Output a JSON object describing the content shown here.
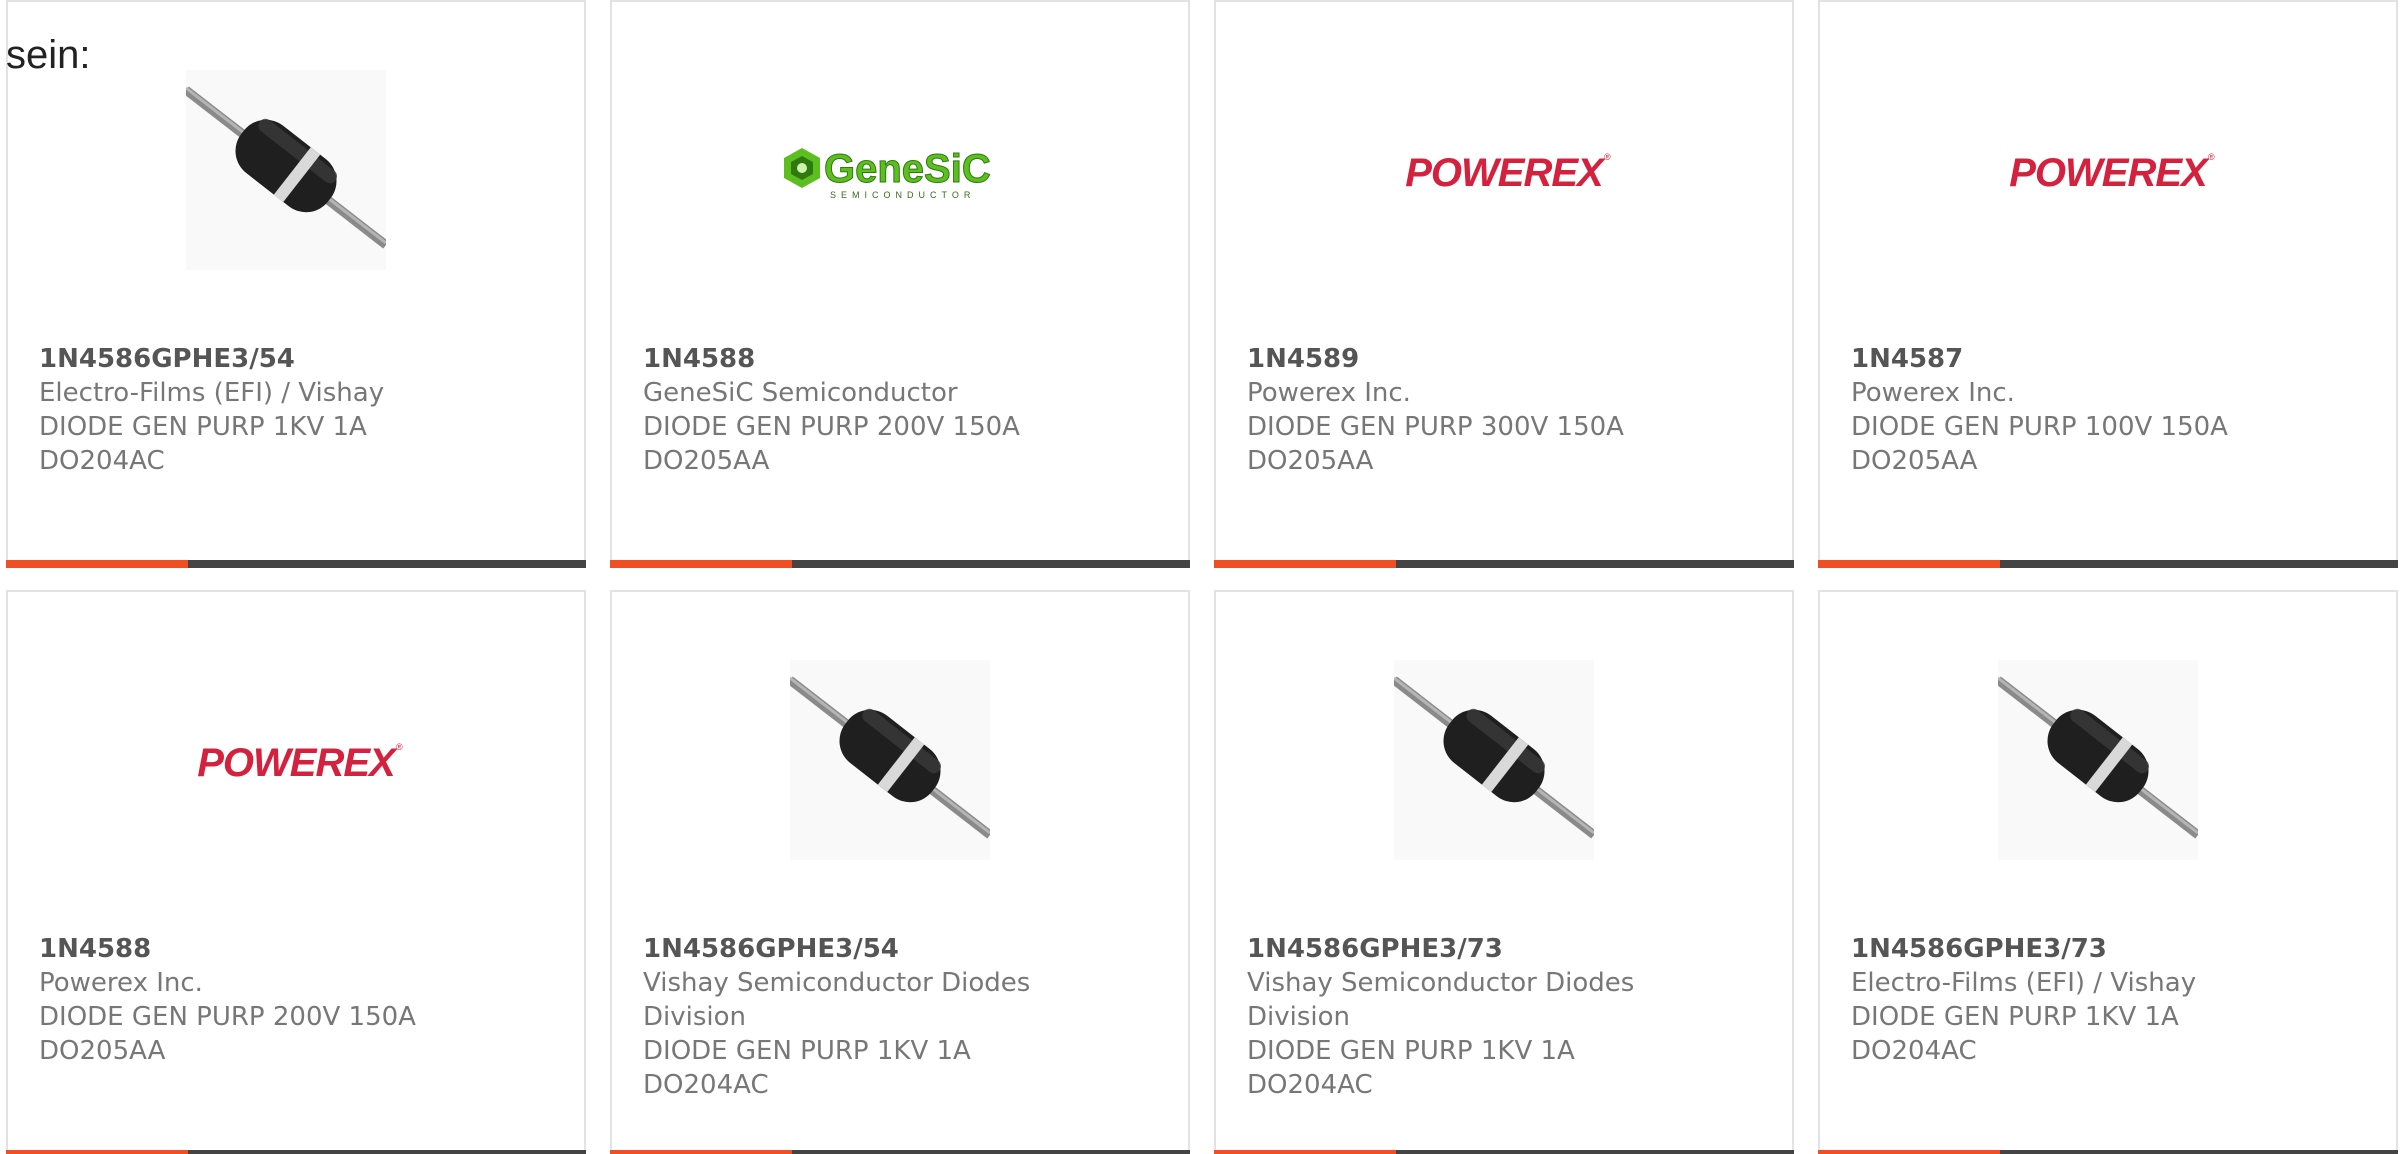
{
  "intro_text": "sein:",
  "colors": {
    "accent": "#f04e23",
    "bar": "#444444",
    "border": "#e2e2e2",
    "genesic_green": "#5dbf1f",
    "powerex_red": "#d4213d"
  },
  "cards": [
    {
      "image": "diode-image",
      "part_number": "1N4586GPHE3/54",
      "manufacturer_lines": [
        "Electro-Films (EFI) / Vishay"
      ],
      "description": "DIODE GEN PURP 1KV 1A",
      "package": "DO204AC"
    },
    {
      "image": "genesic-logo",
      "logo_text": "GeneSiC",
      "logo_sub": "SEMICONDUCTOR",
      "part_number": "1N4588",
      "manufacturer_lines": [
        "GeneSiC Semiconductor"
      ],
      "description": "DIODE GEN PURP 200V 150A",
      "package": "DO205AA"
    },
    {
      "image": "powerex-logo",
      "logo_text": "POWEREX",
      "part_number": "1N4589",
      "manufacturer_lines": [
        "Powerex Inc."
      ],
      "description": "DIODE GEN PURP 300V 150A",
      "package": "DO205AA"
    },
    {
      "image": "powerex-logo",
      "logo_text": "POWEREX",
      "part_number": "1N4587",
      "manufacturer_lines": [
        "Powerex Inc."
      ],
      "description": "DIODE GEN PURP 100V 150A",
      "package": "DO205AA"
    },
    {
      "image": "powerex-logo",
      "logo_text": "POWEREX",
      "part_number": "1N4588",
      "manufacturer_lines": [
        "Powerex Inc."
      ],
      "description": "DIODE GEN PURP 200V 150A",
      "package": "DO205AA"
    },
    {
      "image": "diode-image",
      "part_number": "1N4586GPHE3/54",
      "manufacturer_lines": [
        "Vishay Semiconductor Diodes",
        "Division"
      ],
      "description": "DIODE GEN PURP 1KV 1A",
      "package": "DO204AC"
    },
    {
      "image": "diode-image",
      "part_number": "1N4586GPHE3/73",
      "manufacturer_lines": [
        "Vishay Semiconductor Diodes",
        "Division"
      ],
      "description": "DIODE GEN PURP 1KV 1A",
      "package": "DO204AC"
    },
    {
      "image": "diode-image",
      "part_number": "1N4586GPHE3/73",
      "manufacturer_lines": [
        "Electro-Films (EFI) / Vishay"
      ],
      "description": "DIODE GEN PURP 1KV 1A",
      "package": "DO204AC"
    }
  ]
}
